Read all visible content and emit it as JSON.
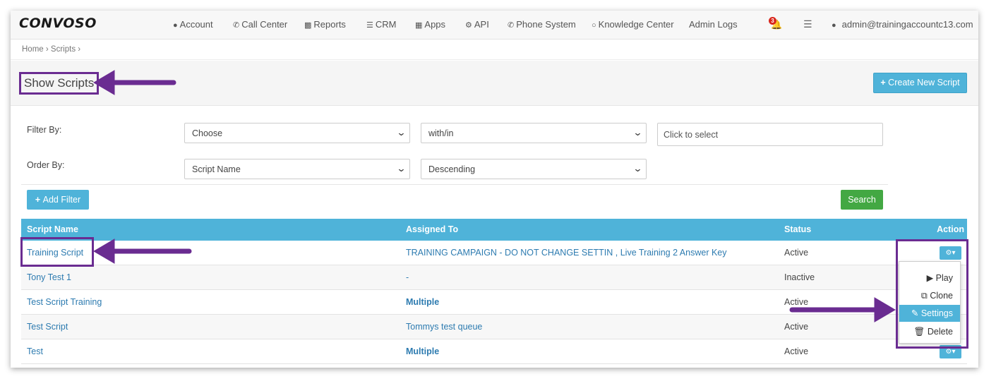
{
  "header": {
    "logo": "CONVOSO",
    "nav": [
      {
        "label": "Account",
        "icon": "user-icon",
        "glyph": "👤"
      },
      {
        "label": "Call Center",
        "icon": "phone-icon",
        "glyph": "✆"
      },
      {
        "label": "Reports",
        "icon": "bar-chart-icon",
        "glyph": "📊"
      },
      {
        "label": "CRM",
        "icon": "list-icon",
        "glyph": "☰"
      },
      {
        "label": "Apps",
        "icon": "grid-icon",
        "glyph": "⋮⋮⋮"
      },
      {
        "label": "API",
        "icon": "gear-icon",
        "glyph": "⚙"
      },
      {
        "label": "Phone System",
        "icon": "phone-icon",
        "glyph": "✆"
      },
      {
        "label": "Knowledge Center",
        "icon": "lightbulb-icon",
        "glyph": "💡"
      },
      {
        "label": "Admin Logs",
        "icon": "",
        "glyph": ""
      }
    ],
    "notification_count": "3",
    "user_email": "admin@trainingaccountc13.com"
  },
  "breadcrumb": [
    "Home",
    "Scripts"
  ],
  "page_title": "Show Scripts",
  "create_button": "Create New Script",
  "filter": {
    "filter_by_label": "Filter By:",
    "filter_field": "Choose",
    "filter_operator": "with/in",
    "filter_value_placeholder": "Click to select",
    "order_by_label": "Order By:",
    "order_field": "Script Name",
    "order_direction": "Descending",
    "add_filter_label": "Add Filter",
    "search_label": "Search"
  },
  "table": {
    "columns": [
      "Script Name",
      "Assigned To",
      "Status",
      "Action"
    ],
    "rows": [
      {
        "name": "Training Script",
        "assigned": "TRAINING CAMPAIGN - DO NOT CHANGE SETTIN , Live Training 2 Answer Key",
        "status": "Active"
      },
      {
        "name": "Tony Test 1",
        "assigned": "-",
        "status": "Inactive"
      },
      {
        "name": "Test Script Training",
        "assigned": "Multiple",
        "status": "Active"
      },
      {
        "name": "Test Script",
        "assigned": "Tommys test queue",
        "status": "Active"
      },
      {
        "name": "Test",
        "assigned": "Multiple",
        "status": "Active"
      }
    ]
  },
  "action_menu": {
    "items": [
      "Play",
      "Clone",
      "Settings",
      "Delete"
    ],
    "selected": "Settings"
  },
  "colors": {
    "accent": "#4fb3d9",
    "success": "#43a843",
    "annotation": "#6a2c91"
  }
}
